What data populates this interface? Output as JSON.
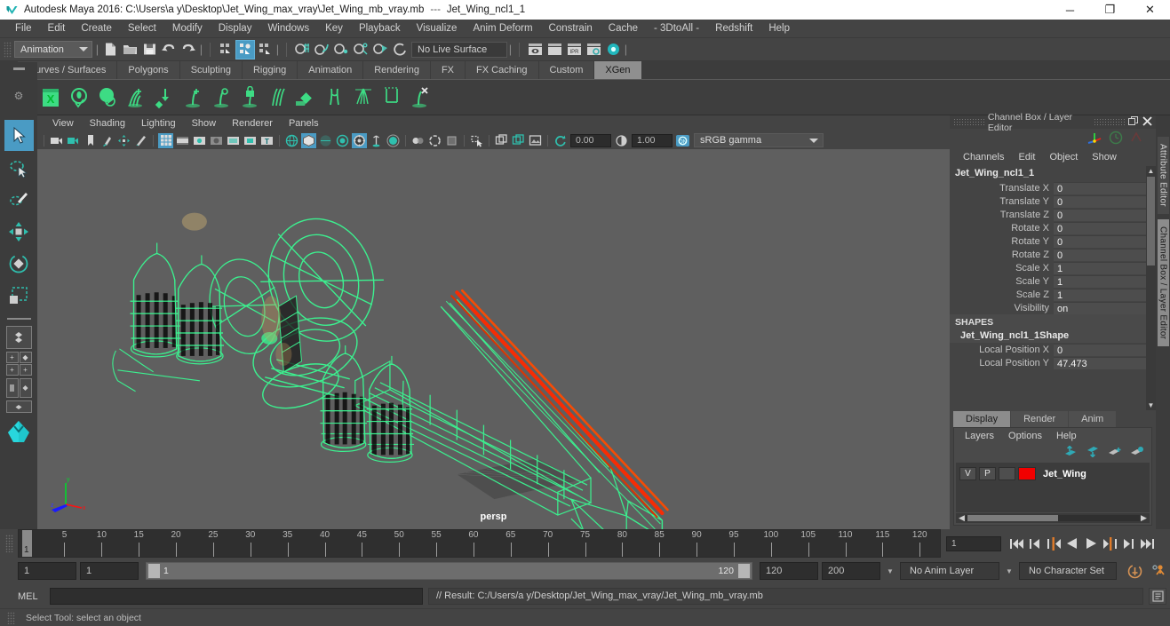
{
  "titlebar": {
    "app_title": "Autodesk Maya 2016: C:\\Users\\a y\\Desktop\\Jet_Wing_max_vray\\Jet_Wing_mb_vray.mb",
    "separator": "---",
    "selection": "Jet_Wing_ncl1_1",
    "minimize": "─",
    "maximize": "❐",
    "close": "✕"
  },
  "menubar": {
    "items": [
      "File",
      "Edit",
      "Create",
      "Select",
      "Modify",
      "Display",
      "Windows",
      "Key",
      "Playback",
      "Visualize",
      "Anim Deform",
      "Constrain",
      "Cache",
      "- 3DtoAll -",
      "Redshift",
      "Help"
    ]
  },
  "statusbar": {
    "menu_set": "Animation",
    "live_surface": "No Live Surface",
    "icons": [
      "new-scene-icon",
      "open-scene-icon",
      "save-scene-icon",
      "undo-icon",
      "redo-icon",
      "select-by-hierarchy-icon",
      "select-by-object-icon",
      "select-by-component-icon",
      "snap-to-grid-icon",
      "snap-to-curve-icon",
      "snap-to-point-icon",
      "snap-to-projected-center-icon",
      "snap-to-view-plane-icon",
      "make-live-icon",
      "render-view-icon",
      "render-sequence-icon",
      "ipr-render-icon",
      "render-settings-icon",
      "hypershade-icon"
    ]
  },
  "shelf": {
    "tabs": [
      "Curves / Surfaces",
      "Polygons",
      "Sculpting",
      "Rigging",
      "Animation",
      "Rendering",
      "FX",
      "FX Caching",
      "Custom",
      "XGen"
    ],
    "active_tab": "XGen",
    "icons": [
      "xgen-editor-icon",
      "create-description-icon",
      "preview-icon",
      "add-groom-icon",
      "place-guides-icon",
      "add-guide-icon",
      "sculpt-guide-icon",
      "lock-guide-icon",
      "comb-icon",
      "density-icon",
      "noise-icon",
      "clumping-icon",
      "cut-icon",
      "delete-guide-icon"
    ]
  },
  "toolbox": {
    "tools": [
      "select-tool",
      "lasso-select-tool",
      "paint-select-tool",
      "move-tool",
      "rotate-tool",
      "scale-tool"
    ],
    "active_tool": "select-tool",
    "layouts": [
      "single-perspective-layout",
      "four-view-layout",
      "two-pane-layout",
      "outliner-persp-layout",
      "hypershade-persp-layout",
      "persp-graph-layout"
    ]
  },
  "viewport": {
    "menus": [
      "View",
      "Shading",
      "Lighting",
      "Show",
      "Renderer",
      "Panels"
    ],
    "camera_label": "persp",
    "exposure": "0.00",
    "gamma": "1.00",
    "color_management": "sRGB gamma",
    "gamma_toggle": "ON",
    "toolbar_icons": [
      "select-camera-icon",
      "lock-camera-icon",
      "bookmark-icon",
      "image-plane-icon",
      "2d-pan-zoom-icon",
      "grease-pencil-icon",
      "grid-icon",
      "film-gate-icon",
      "resolution-gate-icon",
      "gate-mask-icon",
      "film-origin-icon",
      "exposure-icon",
      "xray-icon",
      "wireframe-icon",
      "smooth-shade-icon",
      "shade-wireframe-icon",
      "textured-icon",
      "use-all-lights-icon",
      "shadows-icon",
      "screen-space-ao-icon",
      "motion-blur-icon",
      "multisample-icon",
      "depth-peel-icon",
      "isolate-select-icon",
      "xray-joints-icon",
      "xray-active-icon",
      "view-image-icon",
      "reset-exposure-icon"
    ],
    "axis": {
      "x": "x",
      "y": "y",
      "z": "z"
    }
  },
  "channelbox": {
    "panel_title": "Channel Box / Layer Editor",
    "menus": [
      "Channels",
      "Edit",
      "Object",
      "Show"
    ],
    "node_name": "Jet_Wing_ncl1_1",
    "transform_channels": [
      {
        "label": "Translate X",
        "value": "0"
      },
      {
        "label": "Translate Y",
        "value": "0"
      },
      {
        "label": "Translate Z",
        "value": "0"
      },
      {
        "label": "Rotate X",
        "value": "0"
      },
      {
        "label": "Rotate Y",
        "value": "0"
      },
      {
        "label": "Rotate Z",
        "value": "0"
      },
      {
        "label": "Scale X",
        "value": "1"
      },
      {
        "label": "Scale Y",
        "value": "1"
      },
      {
        "label": "Scale Z",
        "value": "1"
      },
      {
        "label": "Visibility",
        "value": "on"
      }
    ],
    "shapes_header": "SHAPES",
    "shape_name": "Jet_Wing_ncl1_1Shape",
    "shape_channels": [
      {
        "label": "Local Position X",
        "value": "0"
      },
      {
        "label": "Local Position Y",
        "value": "47.473"
      }
    ]
  },
  "layer_editor": {
    "tabs": [
      "Display",
      "Render",
      "Anim"
    ],
    "active_tab": "Display",
    "menus": [
      "Layers",
      "Options",
      "Help"
    ],
    "buttons": [
      "move-layer-up-icon",
      "move-layer-down-icon",
      "new-layer-icon",
      "new-layer-from-selected-icon"
    ],
    "layers": [
      {
        "visibility": "V",
        "playback": "P",
        "state": "",
        "color": "#f20000",
        "name": "Jet_Wing"
      }
    ]
  },
  "vertical_tabs": [
    "Attribute Editor",
    "Channel Box / Layer Editor"
  ],
  "timeline": {
    "ticks": [
      5,
      10,
      15,
      20,
      25,
      30,
      35,
      40,
      45,
      50,
      55,
      60,
      65,
      70,
      75,
      80,
      85,
      90,
      95,
      100,
      105,
      110,
      115,
      120
    ],
    "current_frame": "1",
    "playhead_label": "1",
    "frame_field": "1",
    "playback_buttons": [
      "go-to-start-icon",
      "step-back-keyframe-icon",
      "step-back-frame-icon",
      "play-backwards-icon",
      "play-forwards-icon",
      "step-forward-frame-icon",
      "step-forward-keyframe-icon",
      "go-to-end-icon"
    ]
  },
  "range": {
    "anim_start": "1",
    "range_start": "1",
    "slider_start_label": "1",
    "slider_end_label": "120",
    "range_end": "120",
    "anim_end": "200",
    "anim_layer": "No Anim Layer",
    "character_set": "No Character Set",
    "auto_key": "auto-keyframe-icon",
    "anim_prefs": "animation-preferences-icon"
  },
  "command_line": {
    "language": "MEL",
    "input_value": "",
    "result": "// Result: C:/Users/a y/Desktop/Jet_Wing_max_vray/Jet_Wing_mb_vray.mb",
    "script_editor_icon": "script-editor-icon"
  },
  "help_line": {
    "text": "Select Tool: select an object"
  },
  "colors": {
    "accent_blue": "#4a9bc4",
    "wireframe_green": "#3cf08f",
    "highlight_red": "#f20000",
    "panel_bg": "#444444",
    "viewport_bg": "#5f5f5f"
  }
}
